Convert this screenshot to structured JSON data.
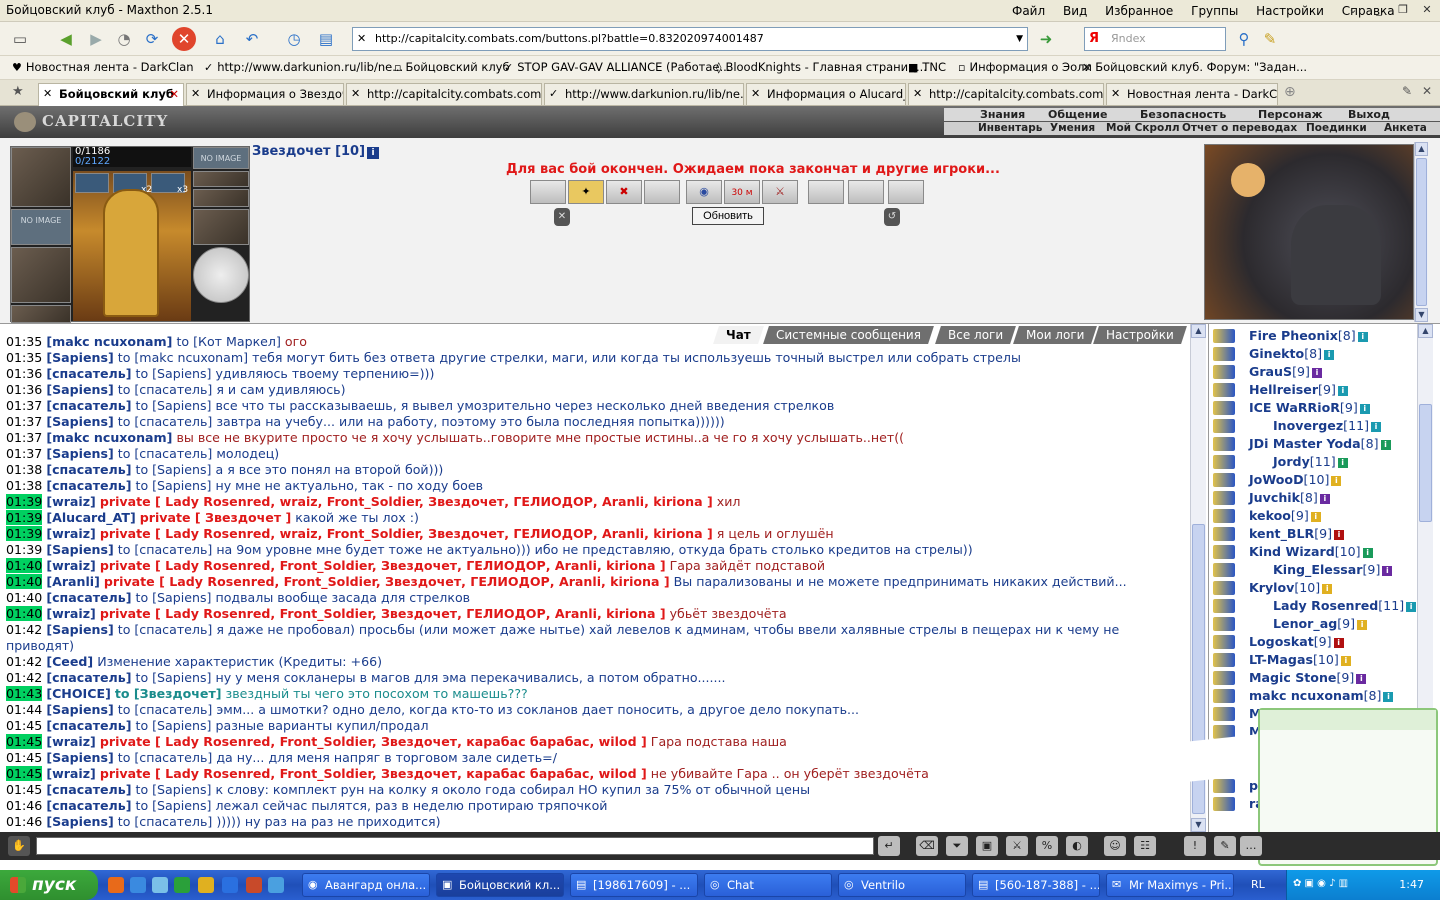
{
  "window": {
    "title": "Бойцовский клуб - Maxthon 2.5.1",
    "menus": [
      "Файл",
      "Вид",
      "Избранное",
      "Группы",
      "Настройки",
      "Справка"
    ]
  },
  "address": {
    "url": "http://capitalcity.combats.com/buttons.pl?battle=0.832020974001487",
    "search_placeholder": "Яndex",
    "search_logo": "Я"
  },
  "bookmarks": [
    "Новостная лента - DarkClan",
    "http://www.darkunion.ru/lib/ne...",
    "Бойцовский клуб",
    "STOP GAV-GAV ALLIANCE (Работае...",
    "BloodKnights - Главная страниц...",
    "TNC",
    "Информация о Эоли",
    "Бойцовский клуб. Форум: \"Задан..."
  ],
  "tabs": [
    "Бойцовский клуб",
    "Информация о Звездочет",
    "http://capitalcity.combats.com/l...",
    "http://www.darkunion.ru/lib/ne...",
    "Информация о Alucard_AT",
    "http://capitalcity.combats.com/l...",
    "Новостная лента - DarkClan"
  ],
  "game": {
    "logo": "CAPITALCITY",
    "nav_top": [
      "Знания",
      "Общение",
      "Безопасность",
      "Персонаж",
      "Выход"
    ],
    "nav_bottom": [
      "Инвентарь",
      "Умения",
      "Мой Скролл",
      "Отчет о переводах",
      "Поединки",
      "Анкета"
    ],
    "hp": "0/1186",
    "mana": "0/2122",
    "no_image": "NO IMAGE",
    "mult_2": "x2",
    "mult_3": "x3",
    "char_name": "Звездочет [10]",
    "info_glyph": "i",
    "battle_msg": "Для вас бой окончен. Ожидаем пока закончат и другие игроки...",
    "timer_badge": "30 м",
    "refresh_button": "Обновить"
  },
  "chat": {
    "tabs": [
      "Чат",
      "Системные сообщения",
      "Все логи",
      "Мои логи",
      "Настройки"
    ],
    "lines": [
      {
        "time": "01:35",
        "hl": false,
        "nick": "[makc ncuxonam]",
        "kind": "to",
        "target": "to [Кот Маркел]",
        "text": "ого",
        "textcls": "pm"
      },
      {
        "time": "01:35",
        "hl": false,
        "nick": "[Sapiens]",
        "kind": "to",
        "target": "to [makc ncuxonam]",
        "text": "тебя могут бить без ответа другие стрелки, маги, или когда ты используешь точный выстрел или собрать стрелы",
        "textcls": "msg"
      },
      {
        "time": "01:36",
        "hl": false,
        "nick": "[спасатель]",
        "kind": "to",
        "target": "to [Sapiens]",
        "text": "удивляюсь твоему терпению=)))",
        "textcls": "msg"
      },
      {
        "time": "01:36",
        "hl": false,
        "nick": "[Sapiens]",
        "kind": "to",
        "target": "to [спасатель]",
        "text": "я и сам удивляюсь)",
        "textcls": "msg"
      },
      {
        "time": "01:37",
        "hl": false,
        "nick": "[спасатель]",
        "kind": "to",
        "target": "to [Sapiens]",
        "text": "все что ты рассказываешь, я вывел умозрительно через несколько дней введения стрелков",
        "textcls": "msg"
      },
      {
        "time": "01:37",
        "hl": false,
        "nick": "[Sapiens]",
        "kind": "to",
        "target": "to [спасатель]",
        "text": "завтра на учебу... или на работу, поэтому это была последняя попытка))))))",
        "textcls": "msg"
      },
      {
        "time": "01:37",
        "hl": false,
        "nick": "[makc ncuxonam]",
        "kind": "none",
        "target": "",
        "text": "вы все не вкурите просто че я хочу услышать..говорите мне простые истины..а че го я хочу услышать..нет((",
        "textcls": "pm"
      },
      {
        "time": "01:37",
        "hl": false,
        "nick": "[Sapiens]",
        "kind": "to",
        "target": "to [спасатель]",
        "text": "молодец)",
        "textcls": "msg"
      },
      {
        "time": "01:38",
        "hl": false,
        "nick": "[спасатель]",
        "kind": "to",
        "target": "to [Sapiens]",
        "text": "а я все это понял на второй бой)))",
        "textcls": "msg"
      },
      {
        "time": "01:38",
        "hl": false,
        "nick": "[спасатель]",
        "kind": "to",
        "target": "to [Sapiens]",
        "text": "ну мне не актуально, так - по ходу боев",
        "textcls": "msg"
      },
      {
        "time": "01:39",
        "hl": true,
        "nick": "[wraiz]",
        "kind": "private",
        "target": "private [ Lady Rosenred, wraiz, Front_Soldier, Звездочет, ГЕЛИОДОР, Aranli, kiriona ]",
        "text": "хил",
        "textcls": "pm"
      },
      {
        "time": "01:39",
        "hl": true,
        "nick": "[Alucard_AT]",
        "kind": "private",
        "target": "private [ Звездочет ]",
        "text": "какой же ты лох :)",
        "textcls": "msg"
      },
      {
        "time": "01:39",
        "hl": true,
        "nick": "[wraiz]",
        "kind": "private",
        "target": "private [ Lady Rosenred, wraiz, Front_Soldier, Звездочет, ГЕЛИОДОР, Aranli, kiriona ]",
        "text": "я цель и оглушён",
        "textcls": "pm"
      },
      {
        "time": "01:39",
        "hl": false,
        "nick": "[Sapiens]",
        "kind": "to",
        "target": "to [спасатель]",
        "text": "на 9ом уровне мне будет тоже не актуально))) ибо не представляю, откуда брать столько кредитов на стрелы))",
        "textcls": "msg"
      },
      {
        "time": "01:40",
        "hl": true,
        "nick": "[wraiz]",
        "kind": "private",
        "target": "private [ Lady Rosenred, Front_Soldier, Звездочет, ГЕЛИОДОР, Aranli, kiriona ]",
        "text": "Гара зайдёт подставой",
        "textcls": "pm"
      },
      {
        "time": "01:40",
        "hl": true,
        "nick": "[Aranli]",
        "kind": "private",
        "target": "private [ Lady Rosenred, Front_Soldier, Звездочет, ГЕЛИОДОР, Aranli, kiriona ]",
        "text": "Вы парализованы и не можете предпринимать никаких действий...",
        "textcls": "msg"
      },
      {
        "time": "01:40",
        "hl": false,
        "nick": "[спасатель]",
        "kind": "to",
        "target": "to [Sapiens]",
        "text": "подвалы вообще засада для стрелков",
        "textcls": "msg"
      },
      {
        "time": "01:40",
        "hl": true,
        "nick": "[wraiz]",
        "kind": "private",
        "target": "private [ Lady Rosenred, Front_Soldier, Звездочет, ГЕЛИОДОР, Aranli, kiriona ]",
        "text": "убьёт звездочёта",
        "textcls": "pm"
      },
      {
        "time": "01:42",
        "hl": false,
        "nick": "[Sapiens]",
        "kind": "to",
        "target": "to [спасатель]",
        "text": "я даже не пробовал) просьбы (или может даже нытье) хай левелов к админам, чтобы ввели халявные стрелы в пещерах ни к чему не приводят)",
        "textcls": "msg",
        "wrap": true
      },
      {
        "time": "01:42",
        "hl": false,
        "nick": "[Ceed]",
        "kind": "none",
        "target": "",
        "text": "Изменение характеристик (Кредиты: +66)",
        "textcls": "sys"
      },
      {
        "time": "01:42",
        "hl": false,
        "nick": "[спасатель]",
        "kind": "to",
        "target": "to [Sapiens]",
        "text": "ну у меня сокланеры в магов для эма перекачивались, а потом обратно.......",
        "textcls": "msg"
      },
      {
        "time": "01:43",
        "hl": true,
        "nick": "[CHOICE]",
        "kind": "toteal",
        "target": "to [Звездочет]",
        "text": "звездный ты чего это посохом то машешь???",
        "textcls": "teal"
      },
      {
        "time": "01:44",
        "hl": false,
        "nick": "[Sapiens]",
        "kind": "to",
        "target": "to [спасатель]",
        "text": "эмм... а шмотки? одно дело, когда кто-то из сокланов дает поносить, а другое дело покупать...",
        "textcls": "msg"
      },
      {
        "time": "01:45",
        "hl": false,
        "nick": "[спасатель]",
        "kind": "to",
        "target": "to [Sapiens]",
        "text": "разные варианты купил/продал",
        "textcls": "msg"
      },
      {
        "time": "01:45",
        "hl": true,
        "nick": "[wraiz]",
        "kind": "private",
        "target": "private [ Lady Rosenred, Front_Soldier, Звездочет, карабас барабас, wilod ]",
        "text": "Гара подстава наша",
        "textcls": "pm"
      },
      {
        "time": "01:45",
        "hl": false,
        "nick": "[Sapiens]",
        "kind": "to",
        "target": "to [спасатель]",
        "text": "да ну... для меня напряг в торговом зале сидеть=/",
        "textcls": "msg"
      },
      {
        "time": "01:45",
        "hl": true,
        "nick": "[wraiz]",
        "kind": "private",
        "target": "private [ Lady Rosenred, Front_Soldier, Звездочет, карабас барабас, wilod ]",
        "text": "не убивайте Гара .. он уберёт звездочёта",
        "textcls": "pm"
      },
      {
        "time": "01:45",
        "hl": false,
        "nick": "[спасатель]",
        "kind": "to",
        "target": "to [Sapiens]",
        "text": "к слову: комплект рун на колку я около года собирал НО купил за 75% от обычной цены",
        "textcls": "msg"
      },
      {
        "time": "01:46",
        "hl": false,
        "nick": "[спасатель]",
        "kind": "to",
        "target": "to [Sapiens]",
        "text": "лежал сейчас пылятся, раз в неделю протираю тряпочкой",
        "textcls": "msg"
      },
      {
        "time": "01:46",
        "hl": false,
        "nick": "[Sapiens]",
        "kind": "to",
        "target": "to [спасатель]",
        "text": "))))) ну раз на раз не приходится)",
        "textcls": "msg"
      }
    ]
  },
  "online": [
    {
      "name": "Fire Pheonix",
      "lvl": "[8]",
      "b": "c"
    },
    {
      "name": "Ginekto",
      "lvl": "[8]",
      "b": "c"
    },
    {
      "name": "GrauS",
      "lvl": "[9]",
      "b": "p"
    },
    {
      "name": "Hellreiser",
      "lvl": "[9]",
      "b": "c"
    },
    {
      "name": "ICE WaRRioR",
      "lvl": "[9]",
      "b": "c"
    },
    {
      "name": "Inovergez",
      "lvl": "[11]",
      "b": "c",
      "indent": true
    },
    {
      "name": "JDi Master Yoda",
      "lvl": "[8]",
      "b": "g"
    },
    {
      "name": "Jordy",
      "lvl": "[11]",
      "b": "g",
      "indent": true
    },
    {
      "name": "JoWooD",
      "lvl": "[10]",
      "b": "y"
    },
    {
      "name": "Juvchik",
      "lvl": "[8]",
      "b": "p"
    },
    {
      "name": "kekoo",
      "lvl": "[9]",
      "b": "y"
    },
    {
      "name": "kent_BLR",
      "lvl": "[9]",
      "b": "r"
    },
    {
      "name": "Kind Wizard",
      "lvl": "[10]",
      "b": "g"
    },
    {
      "name": "King_Elessar",
      "lvl": "[9]",
      "b": "p",
      "indent": true
    },
    {
      "name": "Krylov",
      "lvl": "[10]",
      "b": "y"
    },
    {
      "name": "Lady Rosenred",
      "lvl": "[11]",
      "b": "c",
      "indent": true
    },
    {
      "name": "Lenor_ag",
      "lvl": "[9]",
      "b": "y",
      "indent": true
    },
    {
      "name": "Logoskat",
      "lvl": "[9]",
      "b": "r"
    },
    {
      "name": "LT-Magas",
      "lvl": "[10]",
      "b": "y"
    },
    {
      "name": "Magic Stone",
      "lvl": "[9]",
      "b": "p"
    },
    {
      "name": "makc ncuxonam",
      "lvl": "[8]",
      "b": "c"
    },
    {
      "name": "M",
      "lvl": "",
      "b": "y"
    },
    {
      "name": "M",
      "lvl": "",
      "b": "y"
    },
    {
      "name": "",
      "lvl": "",
      "b": "y"
    },
    {
      "name": "",
      "lvl": "",
      "b": "y"
    },
    {
      "name": "prof",
      "lvl": "[9]",
      "b": "y"
    },
    {
      "name": "ramzes orc",
      "lvl": "[9]",
      "b": "y"
    }
  ],
  "taskbar": {
    "start": "пуск",
    "items": [
      "Авангард онла...",
      "Бойцовский кл...",
      "[198617609] - ...",
      "Chat",
      "Ventrilo",
      "[560-187-388] - ...",
      "Mr Maximys - Pri..."
    ],
    "lang": "RL",
    "clock": "1:47"
  },
  "colors": {
    "accent": "#1a3c8c",
    "private": "#e01818",
    "highlight": "#00d060",
    "teal": "#1a8c8c"
  }
}
